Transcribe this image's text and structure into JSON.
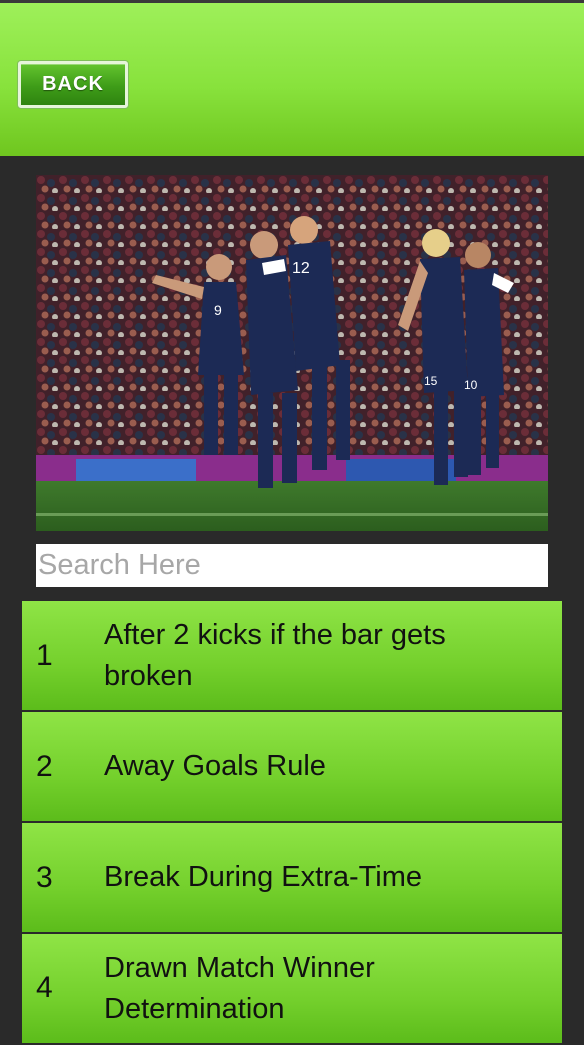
{
  "header": {
    "back_label": "BACK"
  },
  "photo": {
    "subject": "Soccer players in navy kits celebrating together in front of a stadium crowd",
    "jersey_numbers": [
      "9",
      "12",
      "15",
      "10"
    ]
  },
  "search": {
    "placeholder": "Search Here",
    "value": ""
  },
  "list": {
    "items": [
      {
        "number": "1",
        "label": "After 2 kicks if the bar gets broken"
      },
      {
        "number": "2",
        "label": "Away Goals Rule"
      },
      {
        "number": "3",
        "label": "Break During Extra-Time"
      },
      {
        "number": "4",
        "label": "Drawn Match Winner Determination"
      }
    ]
  },
  "colors": {
    "header_green": "#88e23c",
    "button_green": "#3e9c18",
    "list_green": "#74d02c",
    "background": "#2a2a2a"
  }
}
